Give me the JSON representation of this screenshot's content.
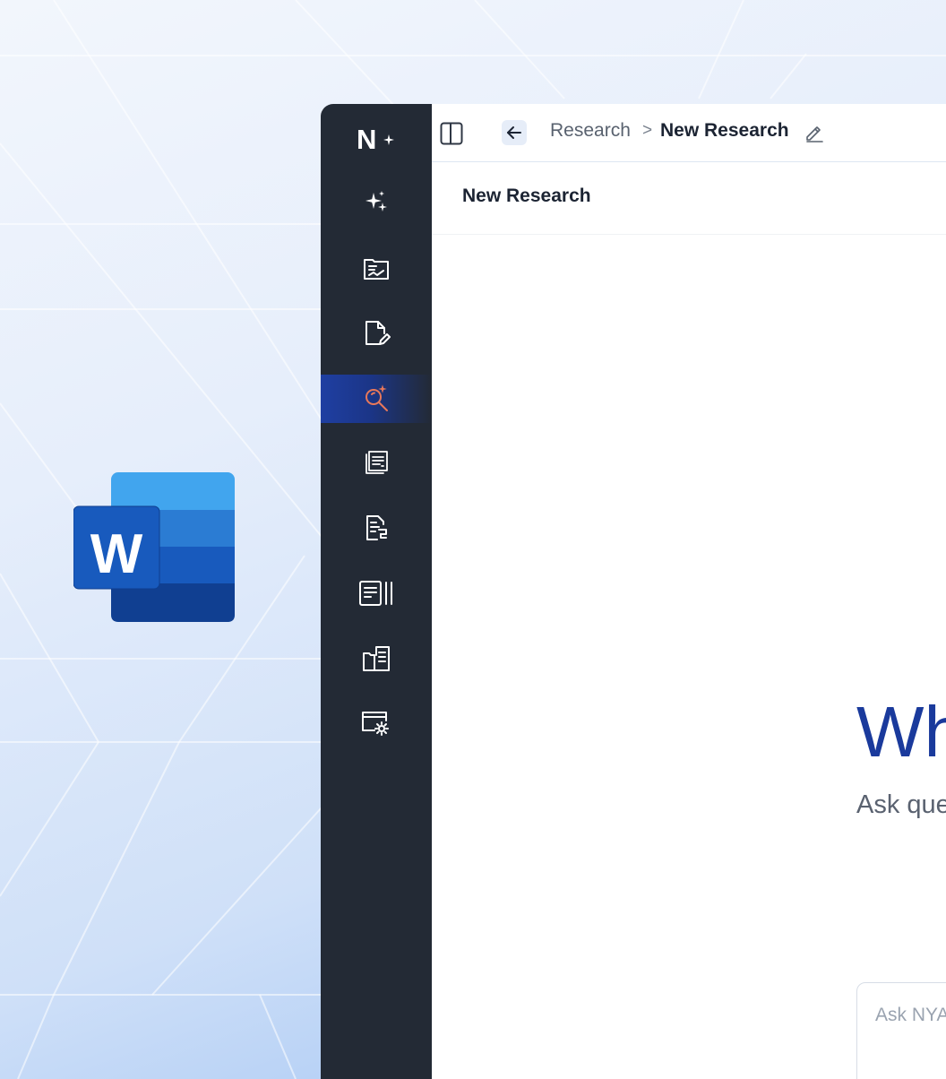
{
  "app": {
    "logo_text": "N",
    "breadcrumb": {
      "root": "Research",
      "separator": ">",
      "current": "New Research"
    },
    "page_title": "New Research",
    "hero": {
      "title_visible": "Wh",
      "subtitle_visible": "Ask que"
    },
    "ask_box": {
      "placeholder": "Ask NYA"
    }
  },
  "sidebar": {
    "items": [
      {
        "icon": "sparkles-icon"
      },
      {
        "icon": "folder-chart-icon"
      },
      {
        "icon": "document-edit-icon"
      },
      {
        "icon": "search-sparkle-icon",
        "active": true
      },
      {
        "icon": "stacked-documents-icon"
      },
      {
        "icon": "document-flow-icon"
      },
      {
        "icon": "document-columns-icon"
      },
      {
        "icon": "folder-document-icon"
      },
      {
        "icon": "browser-settings-icon"
      }
    ]
  },
  "colors": {
    "sidebar_bg": "#232a35",
    "active_icon": "#e8785a",
    "accent": "#1a3a9c"
  }
}
